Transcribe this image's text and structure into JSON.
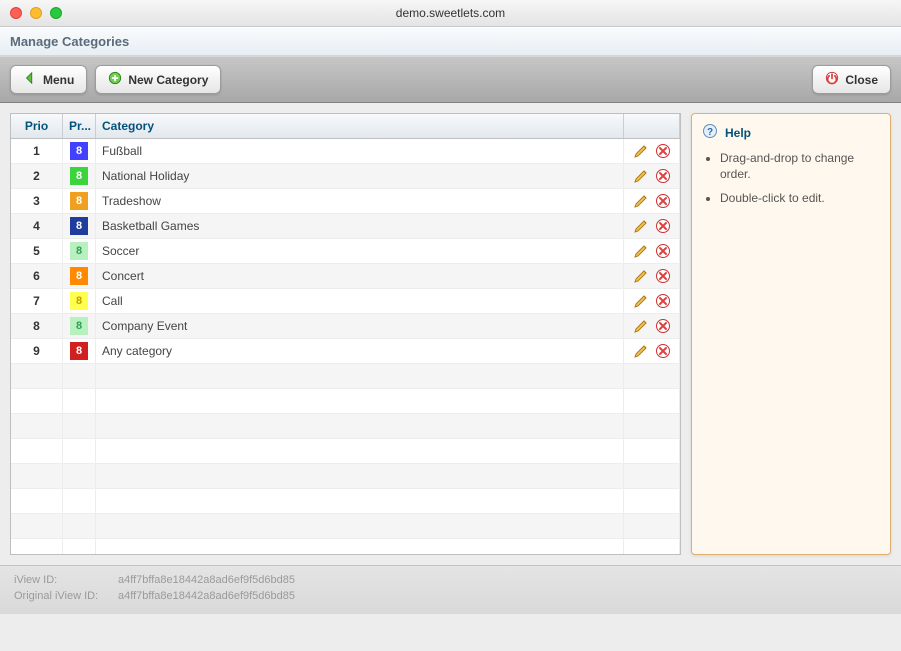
{
  "chrome": {
    "host": "demo.sweetlets.com"
  },
  "header": {
    "title": "Manage Categories"
  },
  "toolbar": {
    "menu_label": "Menu",
    "new_category_label": "New Category",
    "close_label": "Close"
  },
  "grid": {
    "headers": {
      "prio": "Prio",
      "pr": "Pr...",
      "category": "Category"
    },
    "swatch_glyph": "8",
    "rows": [
      {
        "prio": "1",
        "color": "#4141ff",
        "text_color": "#ffffff",
        "category": "Fußball"
      },
      {
        "prio": "2",
        "color": "#3cd43c",
        "text_color": "#ffffff",
        "category": "National Holiday"
      },
      {
        "prio": "3",
        "color": "#f0a020",
        "text_color": "#ffffff",
        "category": "Tradeshow"
      },
      {
        "prio": "4",
        "color": "#1f3d9c",
        "text_color": "#ffffff",
        "category": "Basketball Games"
      },
      {
        "prio": "5",
        "color": "#b8f0c0",
        "text_color": "#30a050",
        "category": "Soccer"
      },
      {
        "prio": "6",
        "color": "#ff8a00",
        "text_color": "#ffffff",
        "category": "Concert"
      },
      {
        "prio": "7",
        "color": "#ffff50",
        "text_color": "#c0a000",
        "category": "Call"
      },
      {
        "prio": "8",
        "color": "#b8f0c0",
        "text_color": "#30a050",
        "category": "Company Event"
      },
      {
        "prio": "9",
        "color": "#d02020",
        "text_color": "#ffffff",
        "category": "Any category"
      }
    ],
    "empty_rows": 8
  },
  "help": {
    "title": "Help",
    "items": [
      "Drag-and-drop to change order.",
      "Double-click to edit."
    ]
  },
  "footer": {
    "iview_label": "iView ID:",
    "iview_value": "a4ff7bffa8e18442a8ad6ef9f5d6bd85",
    "orig_label": "Original iView ID:",
    "orig_value": "a4ff7bffa8e18442a8ad6ef9f5d6bd85"
  }
}
